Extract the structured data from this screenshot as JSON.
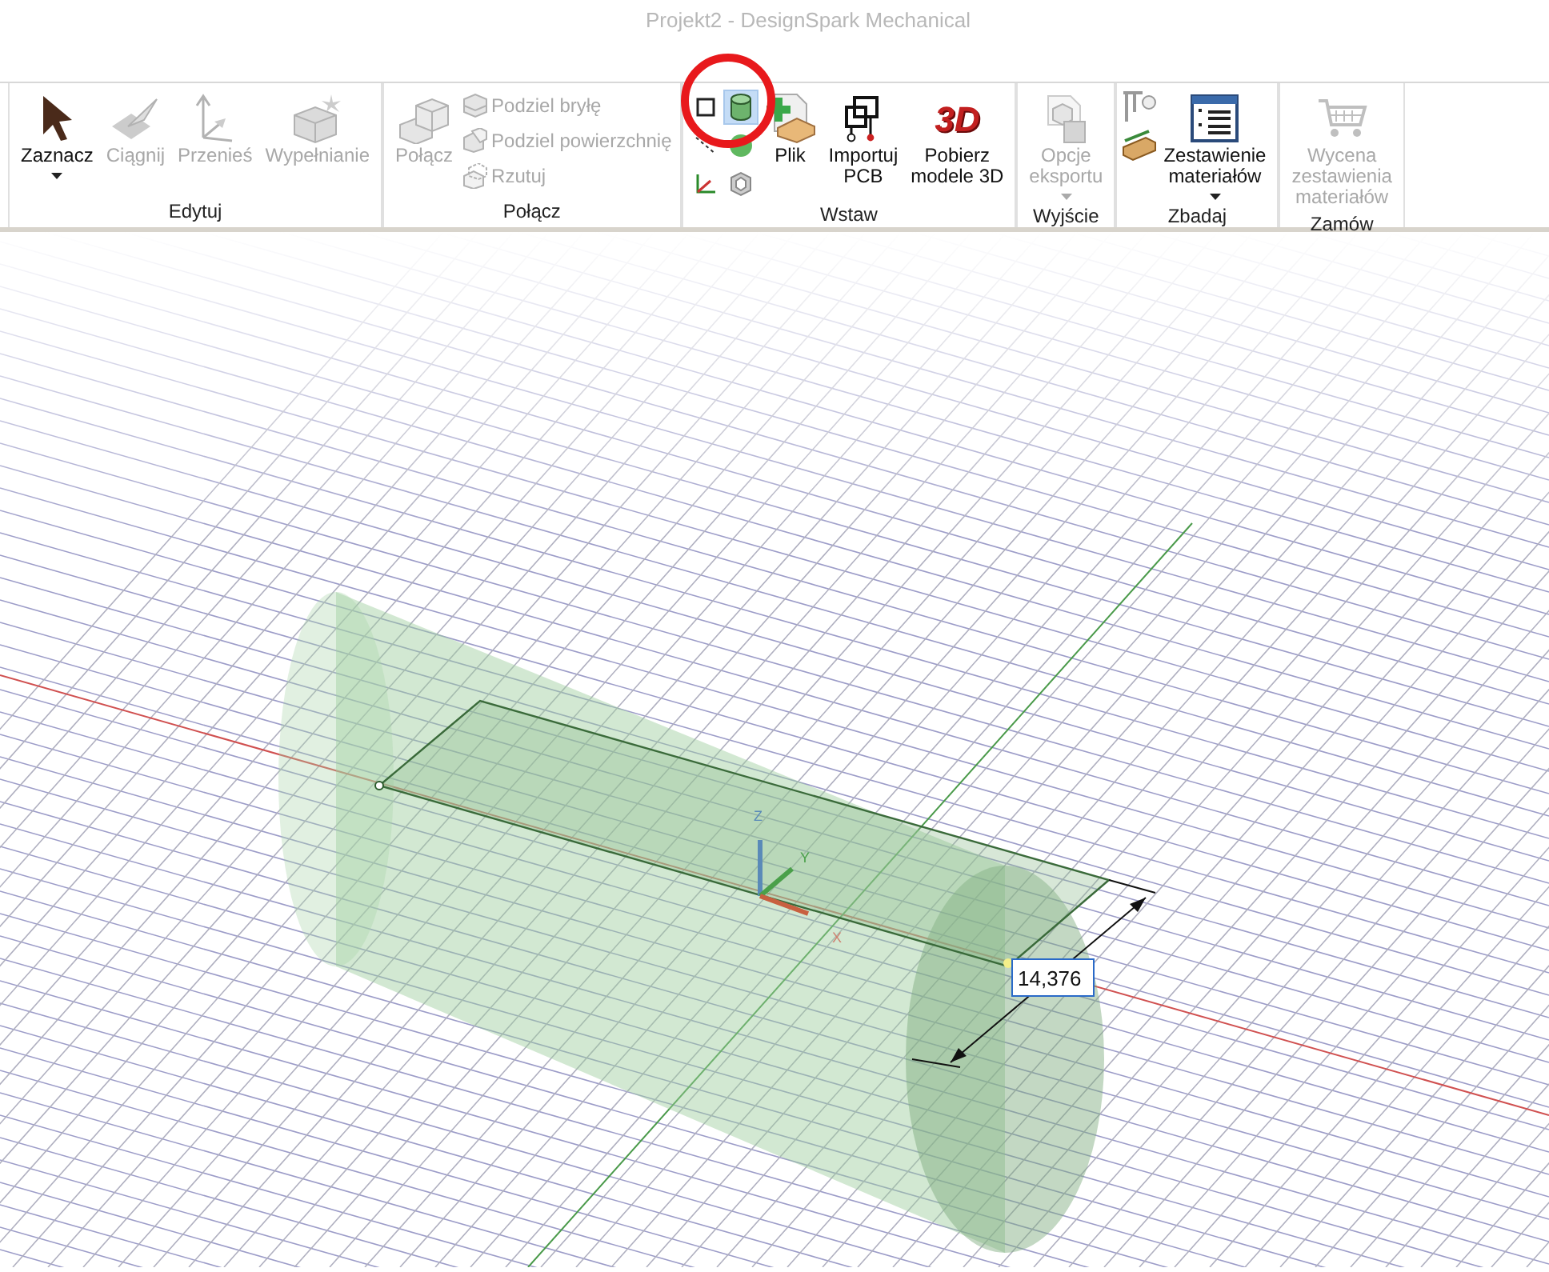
{
  "window": {
    "title": "Projekt2 - DesignSpark Mechanical"
  },
  "ribbon": {
    "groups": [
      {
        "label": "Edytuj",
        "columns": [
          [
            {
              "kind": "large",
              "label": "Zaznacz",
              "disabled": false,
              "dropdown": true
            }
          ],
          [
            {
              "kind": "large",
              "label": "Ciągnij",
              "disabled": true,
              "dropdown": false
            }
          ],
          [
            {
              "kind": "large",
              "label": "Przenieś",
              "disabled": true,
              "dropdown": false
            }
          ],
          [
            {
              "kind": "large",
              "label": "Wypełnianie",
              "disabled": true,
              "dropdown": false
            }
          ]
        ]
      },
      {
        "label": "Połącz",
        "columns": [
          [
            {
              "kind": "large",
              "label": "Połącz",
              "disabled": true,
              "dropdown": false
            }
          ],
          [
            {
              "kind": "small",
              "label": "Podziel bryłę",
              "disabled": true
            },
            {
              "kind": "small",
              "label": "Podziel powierzchnię",
              "disabled": true
            },
            {
              "kind": "small",
              "label": "Rzutuj",
              "disabled": true
            }
          ]
        ]
      },
      {
        "label": "Wstaw",
        "columns": [
          [
            {
              "kind": "icon",
              "selected": false
            },
            {
              "kind": "icon",
              "selected": false
            },
            {
              "kind": "icon",
              "selected": false
            }
          ],
          [
            {
              "kind": "icon",
              "selected": true
            },
            {
              "kind": "icon",
              "selected": false
            },
            {
              "kind": "icon",
              "selected": false
            }
          ],
          [
            {
              "kind": "large",
              "label": "Plik",
              "disabled": false,
              "dropdown": false
            }
          ],
          [
            {
              "kind": "large",
              "label": "Importuj\nPCB",
              "disabled": false,
              "dropdown": false
            }
          ],
          [
            {
              "kind": "large",
              "label": "Pobierz\nmodele 3D",
              "disabled": false,
              "dropdown": false,
              "icon_text": "3D"
            }
          ]
        ]
      },
      {
        "label": "Wyjście",
        "columns": [
          [
            {
              "kind": "large",
              "label": "Opcje\neksportu",
              "disabled": true,
              "dropdown": true
            }
          ]
        ]
      },
      {
        "label": "Zbadaj",
        "columns": [
          [
            {
              "kind": "icon",
              "selected": false
            },
            {
              "kind": "icon",
              "selected": false
            }
          ],
          [
            {
              "kind": "large",
              "label": "Zestawienie\nmateriałów",
              "disabled": false,
              "dropdown": true
            }
          ]
        ]
      },
      {
        "label": "Zamów",
        "columns": [
          [
            {
              "kind": "large",
              "label": "Wycena\nzestawienia\nmateriałów",
              "disabled": true,
              "dropdown": false
            }
          ]
        ]
      }
    ]
  },
  "viewport": {
    "triad_labels": [
      "Z",
      "Y",
      "X"
    ],
    "dimension": {
      "value": "14,376"
    }
  }
}
